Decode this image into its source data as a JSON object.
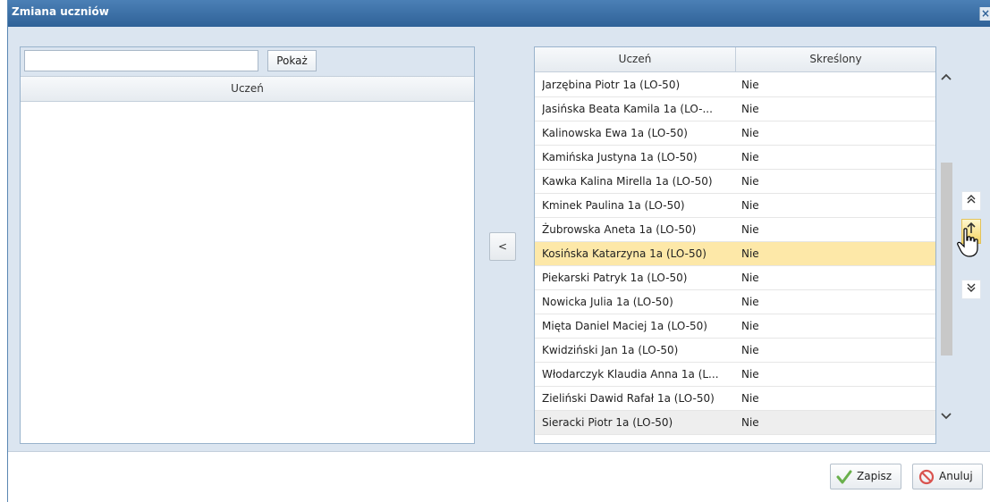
{
  "window": {
    "title": "Zmiana uczniów",
    "close_label": "×"
  },
  "left": {
    "search_value": "",
    "search_placeholder": "",
    "show_button": "Pokaż",
    "column_student": "Uczeń"
  },
  "transfer_button": "<",
  "right": {
    "columns": {
      "student": "Uczeń",
      "struck": "Skreślony"
    },
    "rows": [
      {
        "name": "Jarzębina Piotr 1a (LO-50)",
        "struck": "Nie"
      },
      {
        "name": "Jasińska Beata Kamila 1a (LO-...",
        "struck": "Nie"
      },
      {
        "name": "Kalinowska Ewa 1a (LO-50)",
        "struck": "Nie"
      },
      {
        "name": "Kamińska Justyna 1a (LO-50)",
        "struck": "Nie"
      },
      {
        "name": "Kawka Kalina Mirella 1a (LO-50)",
        "struck": "Nie"
      },
      {
        "name": "Kminek Paulina 1a (LO-50)",
        "struck": "Nie"
      },
      {
        "name": "Żubrowska Aneta 1a (LO-50)",
        "struck": "Nie"
      },
      {
        "name": "Kosińska Katarzyna 1a (LO-50)",
        "struck": "Nie"
      },
      {
        "name": "Piekarski Patryk 1a (LO-50)",
        "struck": "Nie"
      },
      {
        "name": "Nowicka Julia 1a (LO-50)",
        "struck": "Nie"
      },
      {
        "name": "Mięta Daniel Maciej 1a (LO-50)",
        "struck": "Nie"
      },
      {
        "name": "Kwidziński Jan 1a (LO-50)",
        "struck": "Nie"
      },
      {
        "name": "Włodarczyk Klaudia Anna 1a (L...",
        "struck": "Nie"
      },
      {
        "name": "Zieliński Dawid Rafał 1a (LO-50)",
        "struck": "Nie"
      },
      {
        "name": "Sieracki Piotr 1a (LO-50)",
        "struck": "Nie"
      }
    ],
    "selected_row": 7
  },
  "footer": {
    "save_label": "Zapisz",
    "cancel_label": "Anuluj"
  },
  "colors": {
    "title_bar": "#3a70a6",
    "selected_row": "#fde8a8",
    "panel_bg": "#dbe5f0",
    "save_check": "#6ab04c",
    "cancel_icon": "#d9534f"
  },
  "icons": {
    "scroll_up": "chevron-up-icon",
    "scroll_down": "chevron-down-icon",
    "move_top": "double-arrow-up-icon",
    "move_up": "arrow-up-icon",
    "move_down": "double-arrow-down-icon"
  }
}
